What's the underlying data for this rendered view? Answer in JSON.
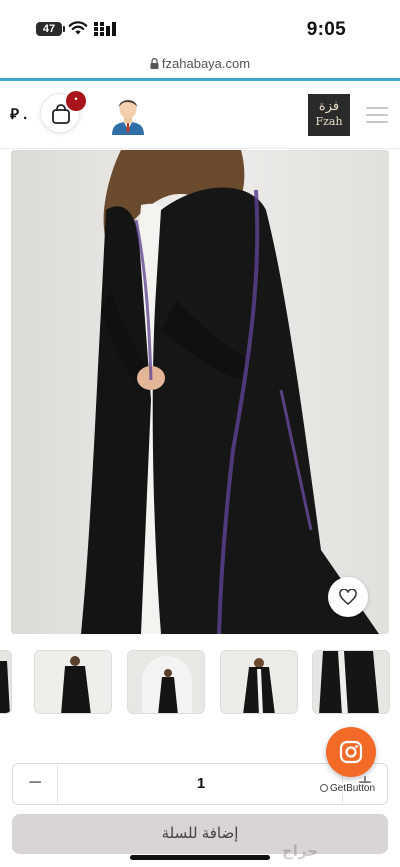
{
  "status_bar": {
    "battery": "47",
    "time": "9:05"
  },
  "browser": {
    "url": "fzahabaya.com"
  },
  "header": {
    "currency_symbol": "⃁ .",
    "cart_badge": "•",
    "logo_ar": "فزة",
    "logo_en": "Fzah"
  },
  "product": {
    "image_alt": "black abaya",
    "thumbnail_count": 5
  },
  "quantity": {
    "minus": "−",
    "value": "1",
    "plus": "+"
  },
  "widget": {
    "getbutton_label": "GetButton"
  },
  "actions": {
    "add_to_cart": "إضافة للسلة"
  },
  "watermark": "حراج",
  "colors": {
    "accent_line": "#3aa8c9",
    "badge": "#a8141a",
    "instagram": "#f26a26",
    "add_to_cart_bg": "#d9d4d6"
  }
}
